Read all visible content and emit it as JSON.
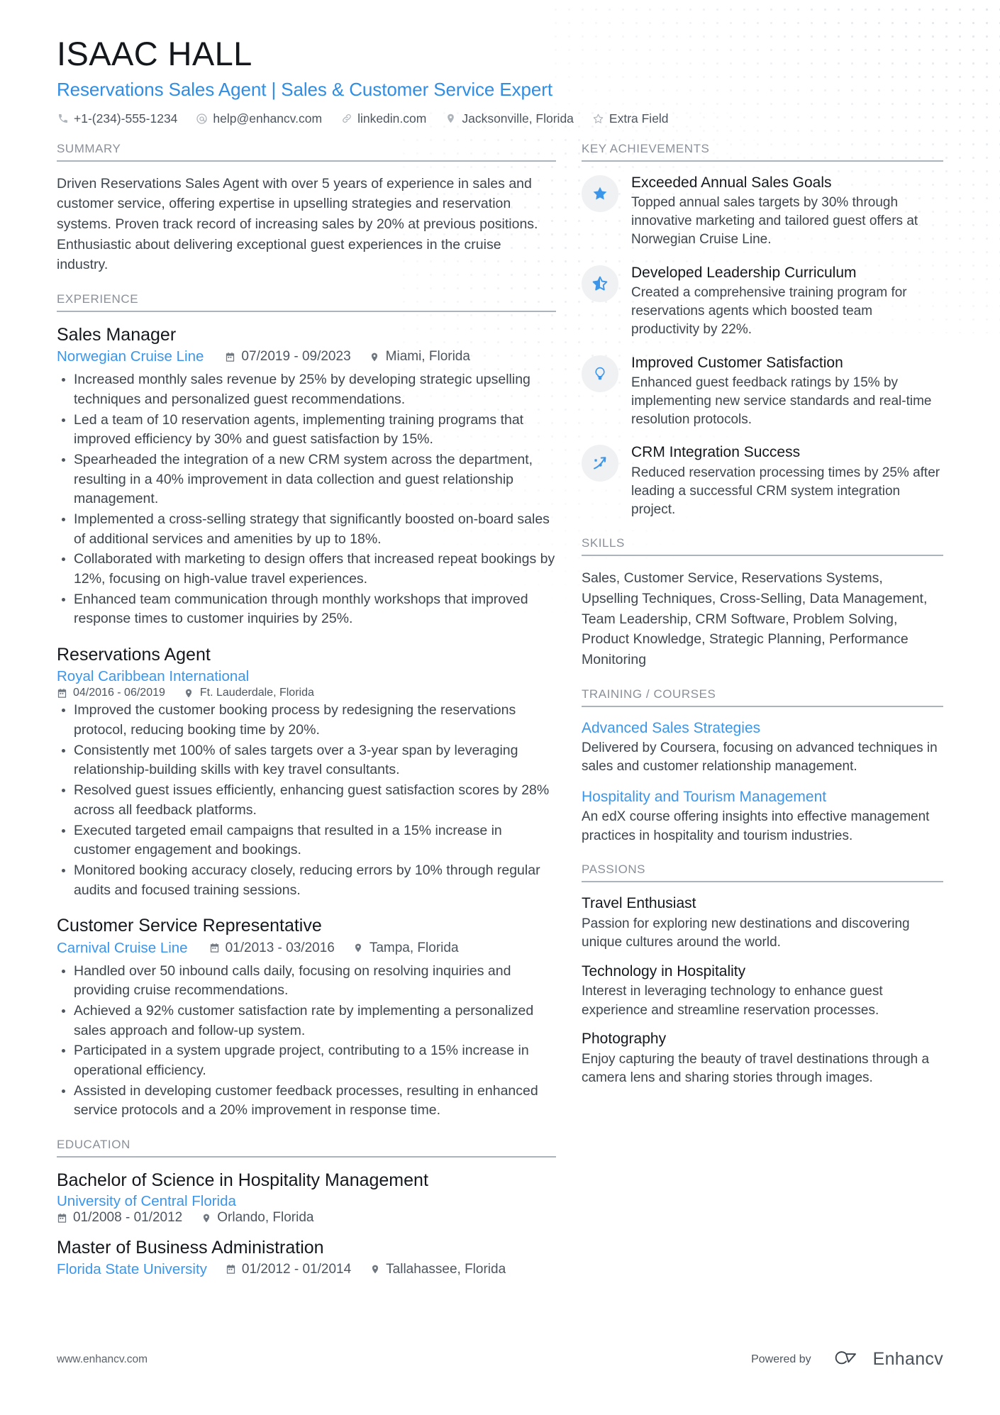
{
  "header": {
    "name": "ISAAC HALL",
    "headline": "Reservations Sales Agent | Sales & Customer Service Expert",
    "contacts": [
      {
        "icon": "phone-icon",
        "text": "+1-(234)-555-1234"
      },
      {
        "icon": "email-icon",
        "text": "help@enhancv.com"
      },
      {
        "icon": "link-icon",
        "text": "linkedin.com"
      },
      {
        "icon": "location-icon",
        "text": "Jacksonville, Florida"
      },
      {
        "icon": "star-outline-icon",
        "text": "Extra Field"
      }
    ]
  },
  "sections": {
    "summary_title": "SUMMARY",
    "experience_title": "EXPERIENCE",
    "education_title": "EDUCATION",
    "achievements_title": "KEY ACHIEVEMENTS",
    "skills_title": "SKILLS",
    "training_title": "TRAINING / COURSES",
    "passions_title": "PASSIONS"
  },
  "summary": {
    "text": "Driven Reservations Sales Agent with over 5 years of experience in sales and customer service, offering expertise in upselling strategies and reservation systems. Proven track record of increasing sales by 20% at previous positions. Enthusiastic about delivering exceptional guest experiences in the cruise industry."
  },
  "experience": [
    {
      "title": "Sales Manager",
      "company": "Norwegian Cruise Line",
      "dates": "07/2019 - 09/2023",
      "location": "Miami, Florida",
      "layout": "inline",
      "bullets": [
        "Increased monthly sales revenue by 25% by developing strategic upselling techniques and personalized guest recommendations.",
        "Led a team of 10 reservation agents, implementing training programs that improved efficiency by 30% and guest satisfaction by 15%.",
        "Spearheaded the integration of a new CRM system across the department, resulting in a 40% improvement in data collection and guest relationship management.",
        "Implemented a cross-selling strategy that significantly boosted on-board sales of additional services and amenities by up to 18%.",
        "Collaborated with marketing to design offers that increased repeat bookings by 12%, focusing on high-value travel experiences.",
        "Enhanced team communication through monthly workshops that improved response times to customer inquiries by 25%."
      ]
    },
    {
      "title": "Reservations Agent",
      "company": "Royal Caribbean International",
      "dates": "04/2016 - 06/2019",
      "location": "Ft. Lauderdale, Florida",
      "layout": "stacked",
      "bullets": [
        "Improved the customer booking process by redesigning the reservations protocol, reducing booking time by 20%.",
        "Consistently met 100% of sales targets over a 3-year span by leveraging relationship-building skills with key travel consultants.",
        "Resolved guest issues efficiently, enhancing guest satisfaction scores by 28% across all feedback platforms.",
        "Executed targeted email campaigns that resulted in a 15% increase in customer engagement and bookings.",
        "Monitored booking accuracy closely, reducing errors by 10% through regular audits and focused training sessions."
      ]
    },
    {
      "title": "Customer Service Representative",
      "company": "Carnival Cruise Line",
      "dates": "01/2013 - 03/2016",
      "location": "Tampa, Florida",
      "layout": "inline",
      "bullets": [
        "Handled over 50 inbound calls daily, focusing on resolving inquiries and providing cruise recommendations.",
        "Achieved a 92% customer satisfaction rate by implementing a personalized sales approach and follow-up system.",
        "Participated in a system upgrade project, contributing to a 15% increase in operational efficiency.",
        "Assisted in developing customer feedback processes, resulting in enhanced service protocols and a 20% improvement in response time."
      ]
    }
  ],
  "education": [
    {
      "degree": "Bachelor of Science in Hospitality Management",
      "school": "University of Central Florida",
      "dates": "01/2008 - 01/2012",
      "location": "Orlando, Florida",
      "layout": "stacked"
    },
    {
      "degree": "Master of Business Administration",
      "school": "Florida State University",
      "dates": "01/2012 - 01/2014",
      "location": "Tallahassee, Florida",
      "layout": "inline"
    }
  ],
  "achievements": [
    {
      "icon": "star-filled-icon",
      "title": "Exceeded Annual Sales Goals",
      "desc": "Topped annual sales targets by 30% through innovative marketing and tailored guest offers at Norwegian Cruise Line."
    },
    {
      "icon": "star-half-icon",
      "title": "Developed Leadership Curriculum",
      "desc": "Created a comprehensive training program for reservations agents which boosted team productivity by 22%."
    },
    {
      "icon": "lightbulb-icon",
      "title": "Improved Customer Satisfaction",
      "desc": "Enhanced guest feedback ratings by 15% by implementing new service standards and real-time resolution protocols."
    },
    {
      "icon": "trending-up-icon",
      "title": "CRM Integration Success",
      "desc": "Reduced reservation processing times by 25% after leading a successful CRM system integration project."
    }
  ],
  "skills": {
    "text": "Sales, Customer Service, Reservations Systems, Upselling Techniques, Cross-Selling, Data Management, Team Leadership, CRM Software, Problem Solving, Product Knowledge, Strategic Planning, Performance Monitoring"
  },
  "training": [
    {
      "title": "Advanced Sales Strategies",
      "desc": "Delivered by Coursera, focusing on advanced techniques in sales and customer relationship management."
    },
    {
      "title": "Hospitality and Tourism Management",
      "desc": "An edX course offering insights into effective management practices in hospitality and tourism industries."
    }
  ],
  "passions": [
    {
      "title": "Travel Enthusiast",
      "desc": "Passion for exploring new destinations and discovering unique cultures around the world."
    },
    {
      "title": "Technology in Hospitality",
      "desc": "Interest in leveraging technology to enhance guest experience and streamline reservation processes."
    },
    {
      "title": "Photography",
      "desc": "Enjoy capturing the beauty of travel destinations through a camera lens and sharing stories through images."
    }
  ],
  "footer": {
    "url": "www.enhancv.com",
    "powered_by": "Powered by",
    "brand": "Enhancv"
  },
  "colors": {
    "accent": "#3b96ea",
    "headline": "#2f8de4",
    "heading_gray": "#8a9099",
    "body": "#3d454d"
  }
}
